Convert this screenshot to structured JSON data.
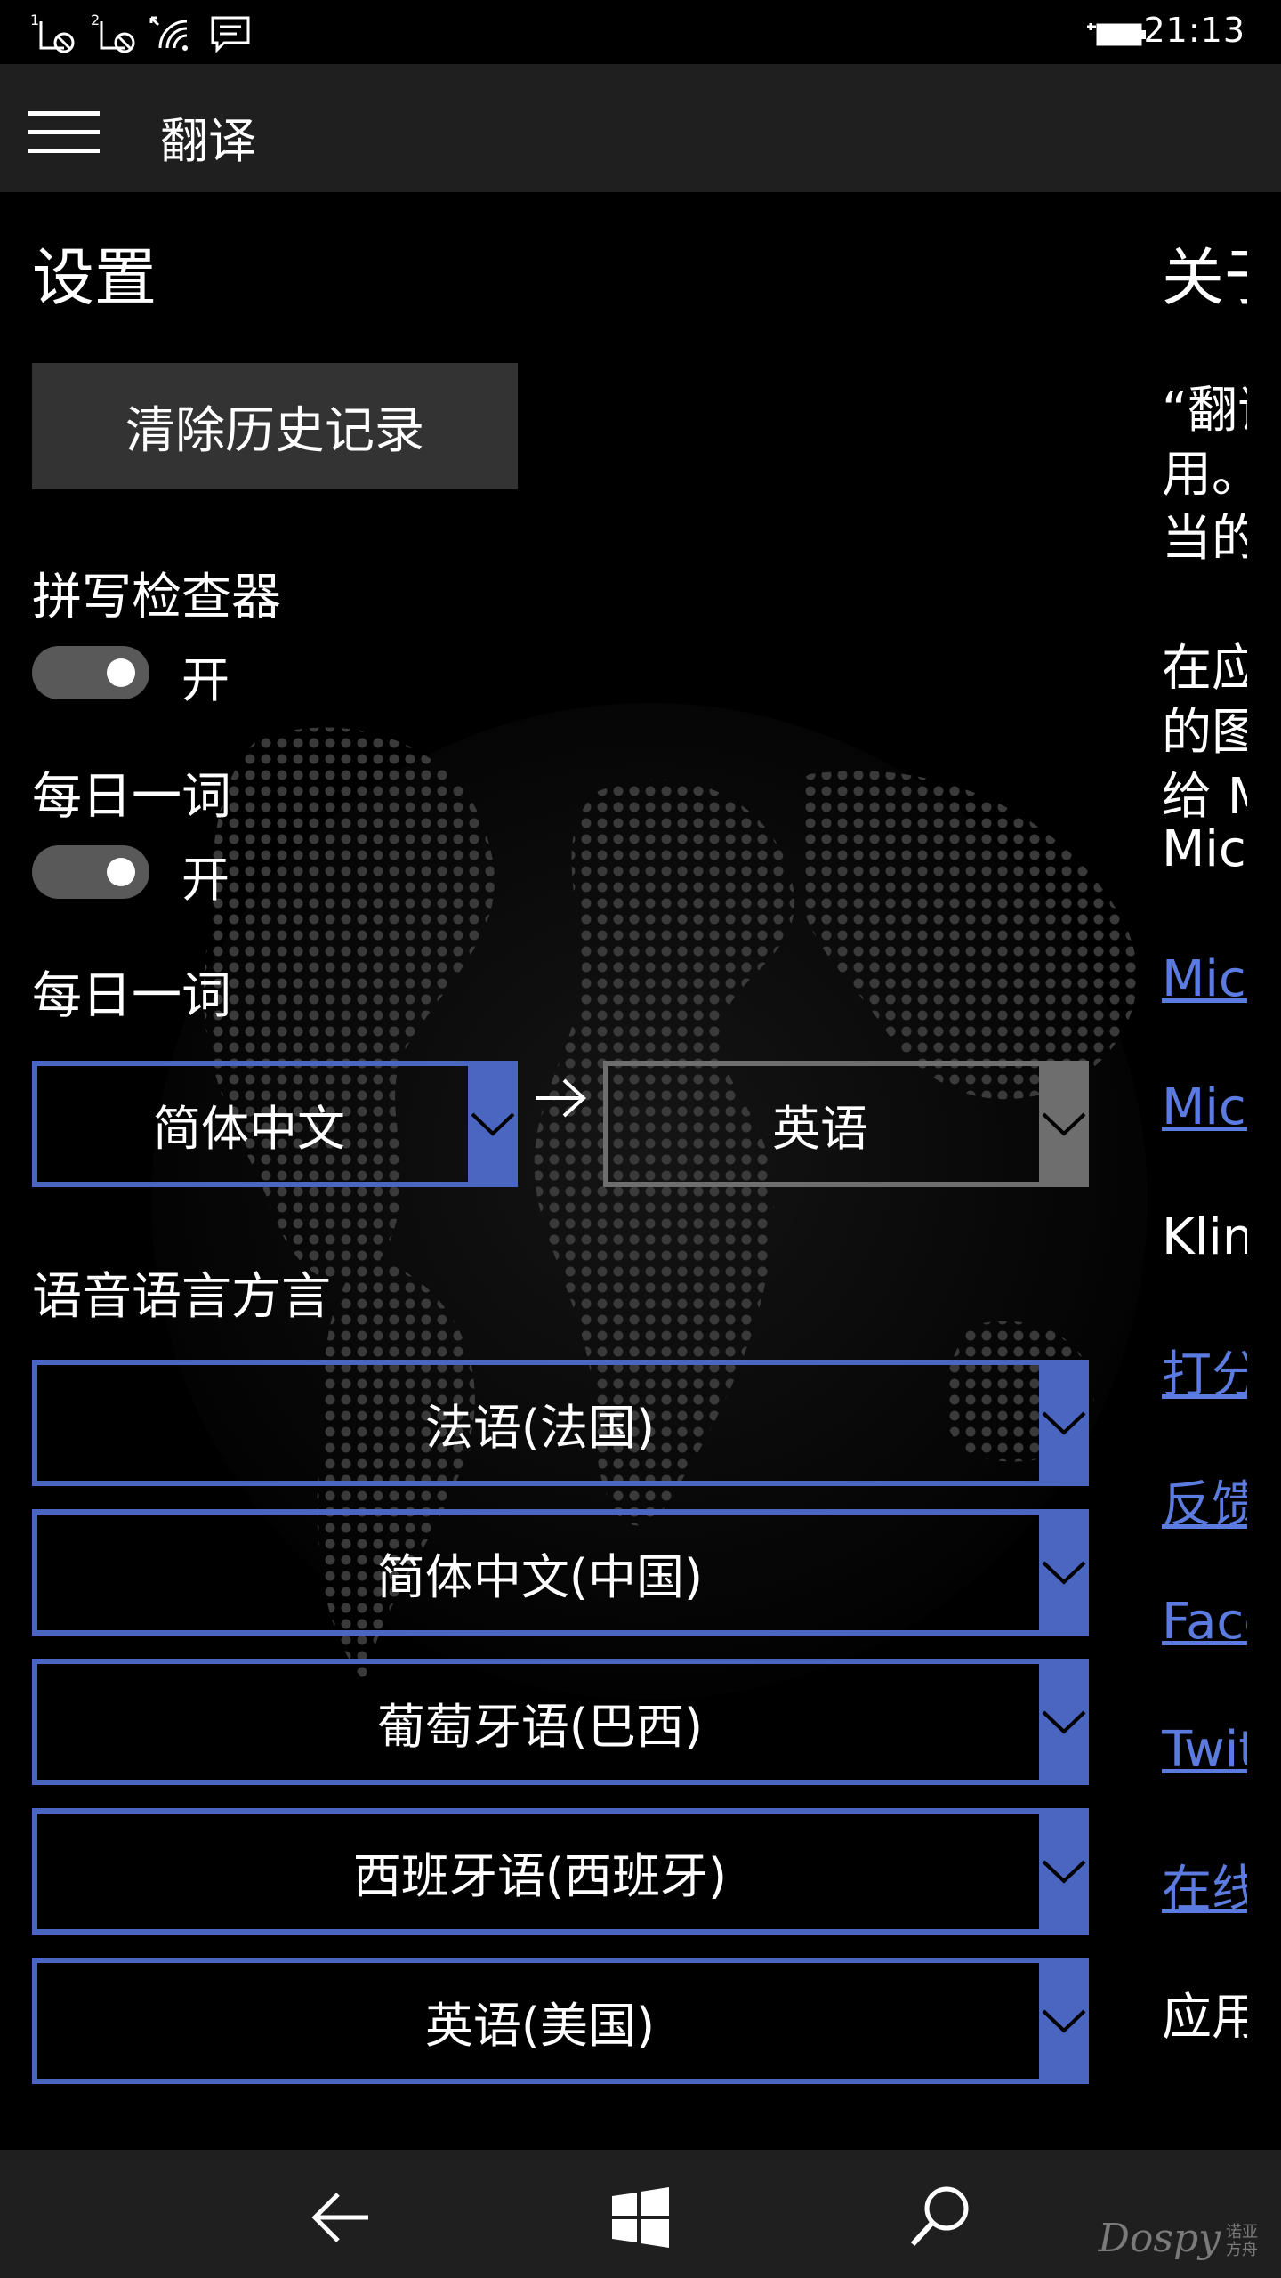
{
  "status_bar": {
    "sim1_label": "1",
    "sim2_label": "2",
    "time": "21:13",
    "icons": [
      "sim1-no-signal-icon",
      "sim2-no-signal-icon",
      "wifi-icon",
      "message-icon",
      "battery-charging-icon"
    ]
  },
  "app_bar": {
    "title": "翻译",
    "menu_icon": "hamburger-icon"
  },
  "settings": {
    "title": "设置",
    "clear_history": "清除历史记录",
    "spell_checker": {
      "label": "拼写检查器",
      "state": "开",
      "on": true
    },
    "word_of_day": {
      "label": "每日一词",
      "state": "开",
      "on": true
    },
    "word_of_day_lang": {
      "label": "每日一词",
      "from": "简体中文",
      "to": "英语"
    },
    "speech_dialect": {
      "label": "语音语言方言",
      "options": [
        "法语(法国)",
        "简体中文(中国)",
        "葡萄牙语(巴西)",
        "西班牙语(西班牙)",
        "英语(美国)"
      ]
    }
  },
  "about_column": {
    "title": "关于",
    "paragraph1": [
      "“翻译",
      "用。",
      "当的"
    ],
    "paragraph2": [
      "在应",
      "的图",
      "给 M",
      "Micr"
    ],
    "links": [
      "Micr",
      "Micr"
    ],
    "plain": "Kling",
    "links2": [
      "打分",
      "反馈",
      "Face",
      "Twit",
      "在线"
    ],
    "footer": "应用"
  },
  "nav_bar": {
    "icons": [
      "back-icon",
      "windows-start-icon",
      "search-icon"
    ]
  },
  "watermark": {
    "brand": "Dospy",
    "small_line1": "诺亚",
    "small_line2": "方舟"
  },
  "colors": {
    "accent": "#4a66c1",
    "link": "#5b7be0",
    "bar": "#1f1f1f",
    "button": "#333333"
  }
}
